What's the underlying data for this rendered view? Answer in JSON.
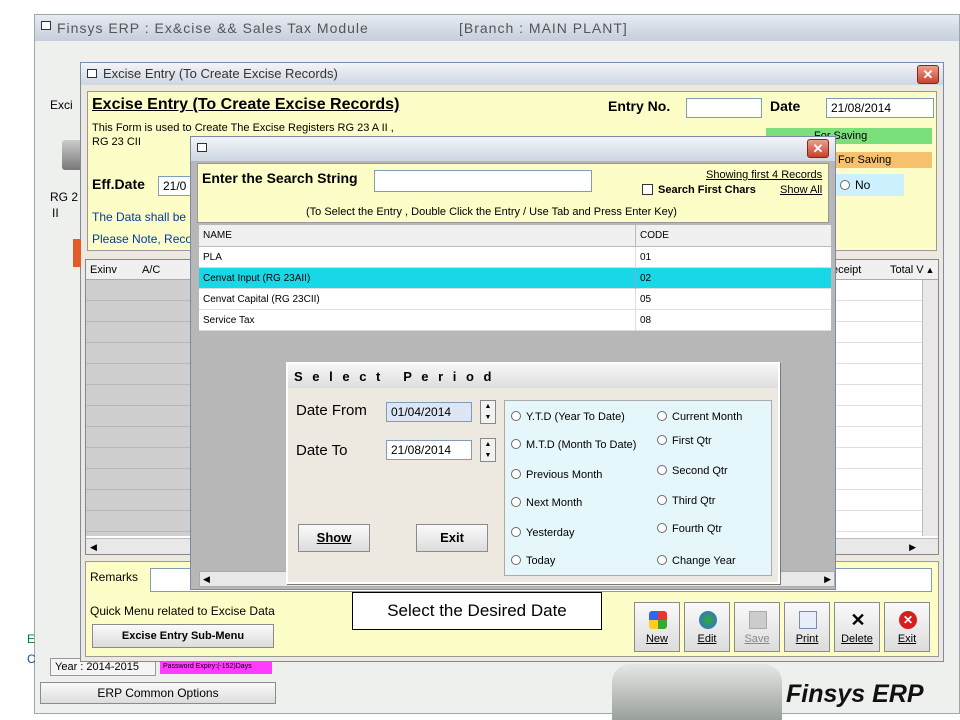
{
  "main": {
    "title": "Finsys ERP : Ex&cise && Sales Tax Module",
    "branch": "[Branch : MAIN PLANT]"
  },
  "left": {
    "exci": "Exci",
    "rg": "RG 2",
    "ii": "II",
    "year": "Year : 2014-2015",
    "password": "Password Expiry:(-152)Days",
    "erp_common": "ERP Common Options",
    "e": "E",
    "c": "C"
  },
  "excise": {
    "window_title": "Excise Entry (To Create Excise Records)",
    "heading": "Excise Entry (To Create Excise Records)",
    "desc1": "This Form is used to Create The Excise Registers RG 23 A II ,",
    "desc2": "RG 23 CII",
    "effdate_label": "Eff.Date",
    "effdate_value": "21/0",
    "note1": "The Data shall be",
    "note2": "Please Note, Reco",
    "entry_no_label": "Entry No.",
    "date_label": "Date",
    "date_value": "21/08/2014",
    "green_text": "For Saving",
    "orange_text": "For Saving",
    "no_option": "No",
    "cols": [
      "Exinv",
      "A/C"
    ],
    "right_cols": [
      "eceipt",
      "Total V"
    ],
    "remarks_label": "Remarks",
    "quick_menu": "Quick Menu related to Excise Data",
    "sub_menu_btn": "Excise Entry Sub-Menu",
    "toolbar": {
      "new": "New",
      "edit": "Edit",
      "save": "Save",
      "print": "Print",
      "delete": "Delete",
      "exit": "Exit"
    }
  },
  "search": {
    "label": "Enter the Search String",
    "showing": "Showing first 4 Records",
    "search_first": "Search First Chars",
    "show_all": "Show All",
    "hint": "(To Select the Entry , Double Click the Entry / Use Tab and Press Enter Key)",
    "headers": [
      "NAME",
      "CODE"
    ],
    "rows": [
      {
        "name": "PLA",
        "code": "01"
      },
      {
        "name": "Cenvat Input (RG 23AII)",
        "code": "02"
      },
      {
        "name": "Cenvat Capital (RG 23CII)",
        "code": "05"
      },
      {
        "name": "Service Tax",
        "code": "08"
      }
    ]
  },
  "period": {
    "title": "S e l e c t   P e r i o d",
    "date_from_label": "Date From",
    "date_from": "01/04/2014",
    "date_to_label": "Date To",
    "date_to": "21/08/2014",
    "show_btn": "Show",
    "exit_btn": "Exit",
    "options_left": [
      "Y.T.D (Year To Date)",
      "M.T.D (Month To Date)",
      "Previous Month",
      "Next Month",
      "Yesterday",
      "Today"
    ],
    "options_right": [
      "Current Month",
      "First Qtr",
      "Second Qtr",
      "Third Qtr",
      "Fourth Qtr",
      "Change Year"
    ]
  },
  "callout": "Select the Desired Date",
  "brand": "Finsys ERP"
}
